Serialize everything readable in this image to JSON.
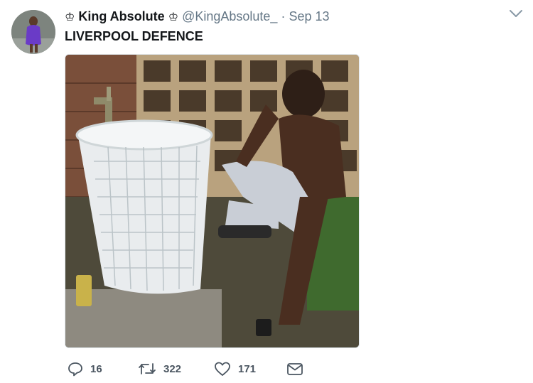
{
  "tweet": {
    "display_name": "King Absolute",
    "handle": "@KingAbsolute_",
    "separator": "·",
    "timestamp": "Sep 13",
    "text": "LIVERPOOL DEFENCE",
    "crown_glyph": "♔"
  },
  "actions": {
    "replies": "16",
    "retweets": "322",
    "likes": "171"
  },
  "icons": {
    "menu": "chevron-down-icon",
    "reply": "reply-icon",
    "retweet": "retweet-icon",
    "like": "heart-icon",
    "dm": "envelope-icon"
  },
  "colors": {
    "text": "#14171a",
    "secondary": "#657786",
    "icon": "#4a5560",
    "border": "#e1e8ed"
  }
}
